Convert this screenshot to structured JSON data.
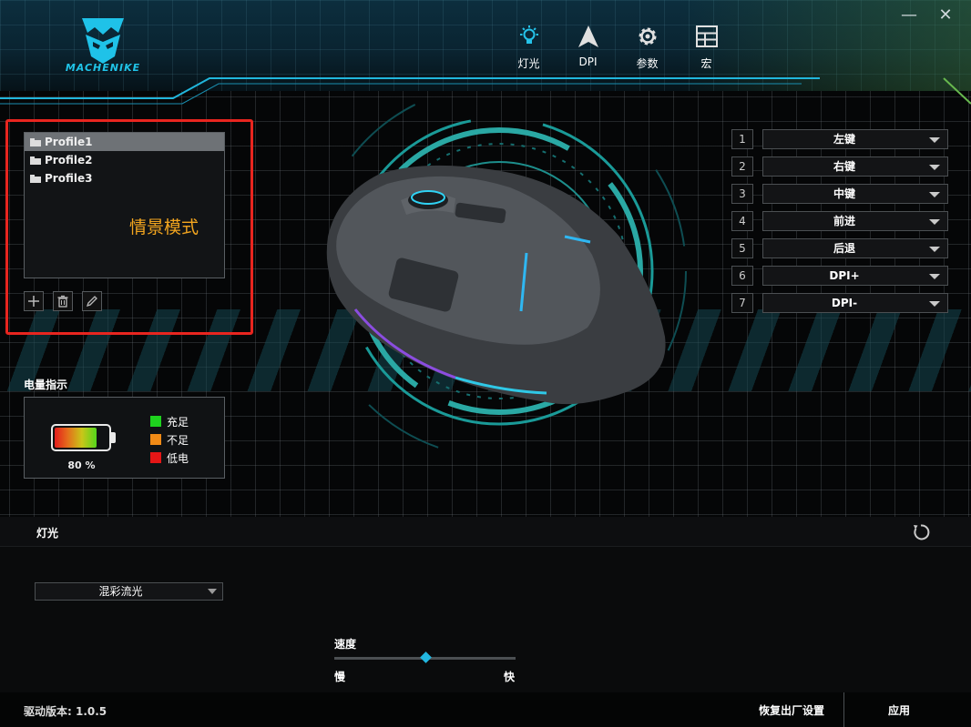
{
  "app": {
    "logo_text": "MACHENIKE"
  },
  "nav": [
    {
      "label": "灯光",
      "icon": "light-bulb-icon"
    },
    {
      "label": "DPI",
      "icon": "arrow-up-icon"
    },
    {
      "label": "参数",
      "icon": "gear-icon"
    },
    {
      "label": "宏",
      "icon": "grid-icon"
    }
  ],
  "window": {
    "minimize": "—",
    "close": "✕"
  },
  "profiles": {
    "items": [
      "Profile1",
      "Profile2",
      "Profile3"
    ],
    "selected_index": 0,
    "annotation": "情景模式",
    "tools": [
      "add-icon",
      "trash-icon",
      "pencil-icon"
    ]
  },
  "battery": {
    "title": "电量指示",
    "percent_text": "80 %",
    "level": 0.8,
    "legend": [
      {
        "label": "充足",
        "color": "#1ed21e"
      },
      {
        "label": "不足",
        "color": "#f08a16"
      },
      {
        "label": "低电",
        "color": "#e41616"
      }
    ]
  },
  "buttons": [
    {
      "num": "1",
      "action": "左键"
    },
    {
      "num": "2",
      "action": "右键"
    },
    {
      "num": "3",
      "action": "中键"
    },
    {
      "num": "4",
      "action": "前进"
    },
    {
      "num": "5",
      "action": "后退"
    },
    {
      "num": "6",
      "action": "DPI+"
    },
    {
      "num": "7",
      "action": "DPI-"
    }
  ],
  "lighting": {
    "title": "灯光",
    "mode": "混彩流光",
    "speed_label": "速度",
    "slow": "慢",
    "fast": "快",
    "speed_level": 0.5
  },
  "footer": {
    "version": "驱动版本: 1.0.5",
    "restore": "恢复出厂设置",
    "apply": "应用"
  },
  "colors": {
    "accent": "#22b7e0",
    "highlight_frame": "#e8251f",
    "annotation": "#f2a51f"
  }
}
